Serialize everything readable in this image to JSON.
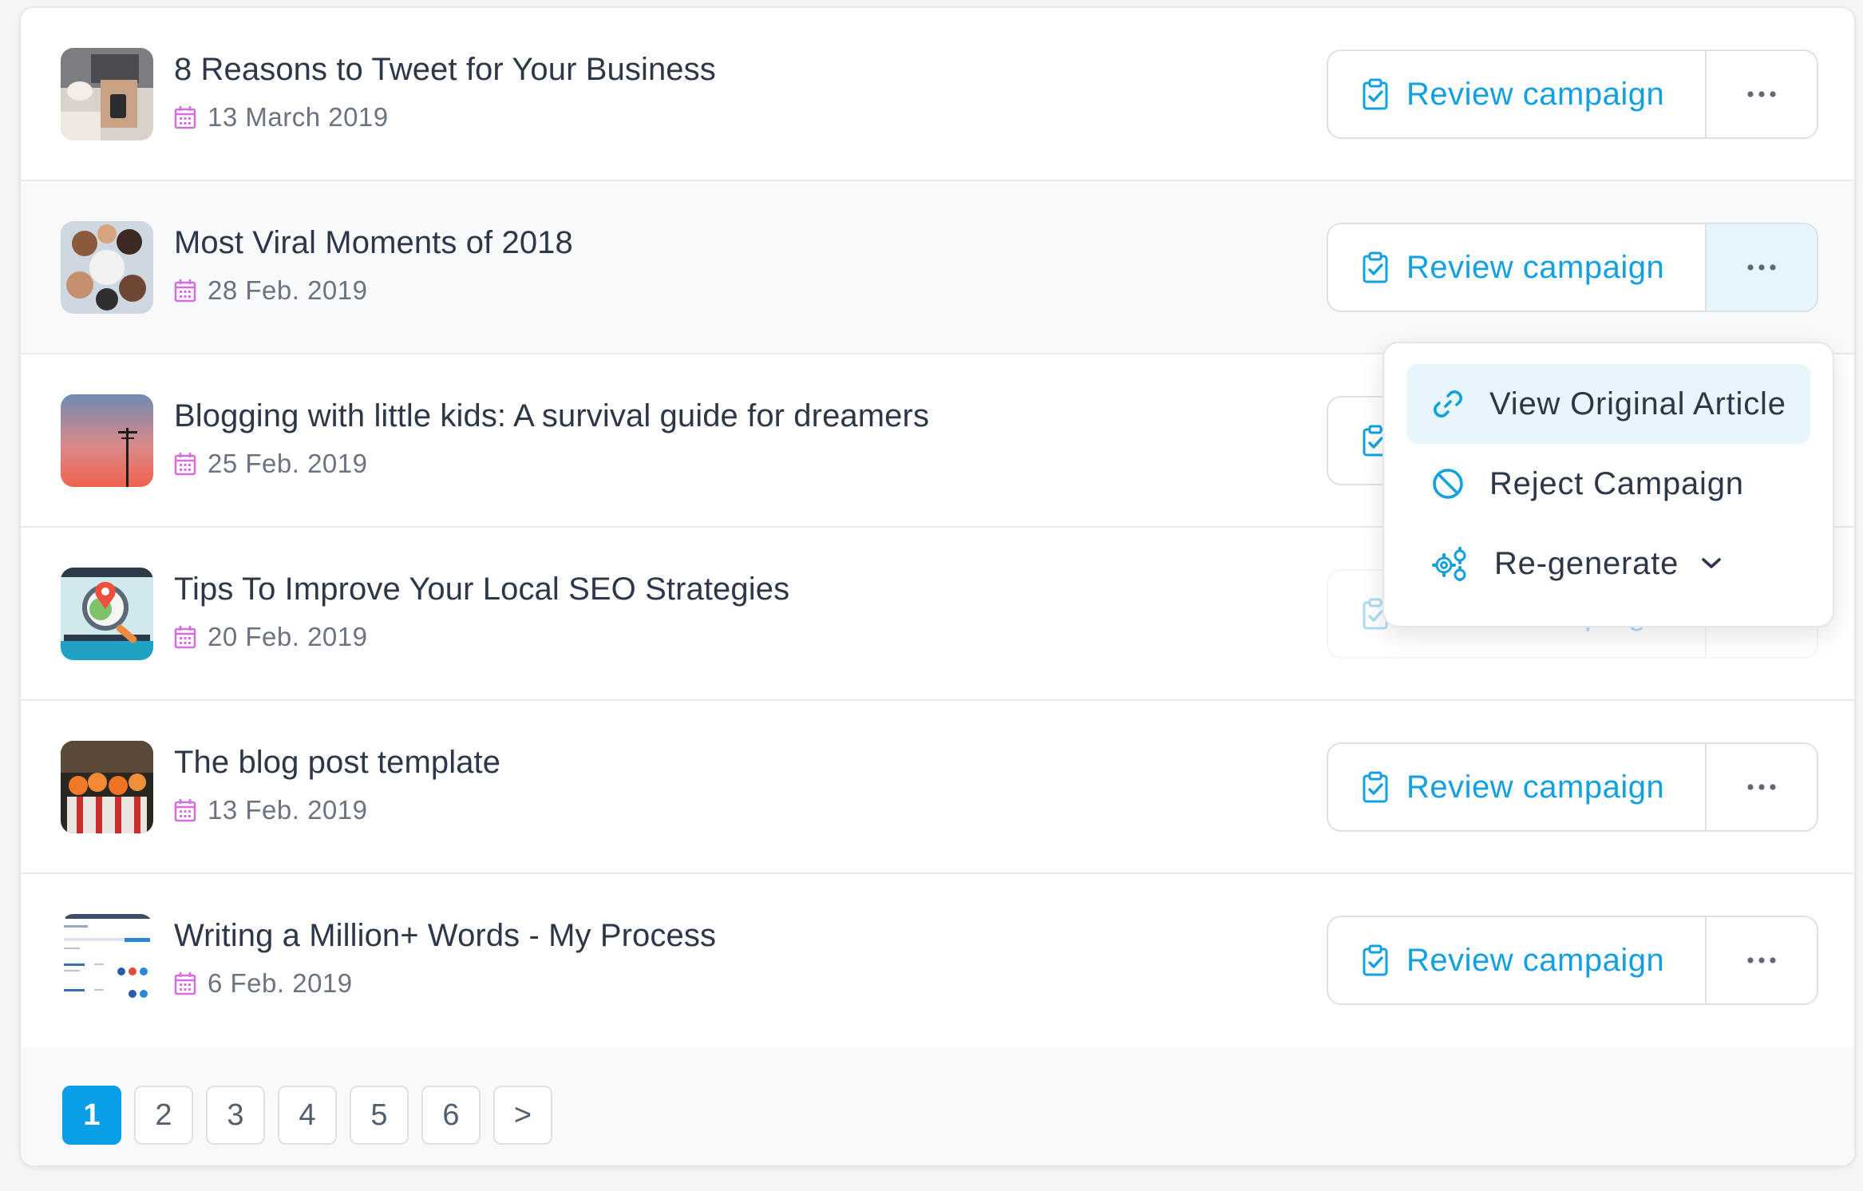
{
  "colors": {
    "accent": "#12a0e0",
    "calendar_icon": "#d46fdc",
    "page_current": "#0b9fe8"
  },
  "review_label": "Review campaign",
  "icons": {
    "calendar": "calendar-icon",
    "review": "clipboard-check-icon",
    "more": "more-horizontal-icon",
    "link": "link-icon",
    "reject": "ban-icon",
    "regenerate": "gears-icon",
    "chevron": "chevron-down-icon"
  },
  "articles": [
    {
      "title": "8 Reasons to Tweet for Your Business",
      "date": "13 March 2019"
    },
    {
      "title": "Most Viral Moments of 2018",
      "date": "28 Feb. 2019"
    },
    {
      "title": "Blogging with little kids: A survival guide for dreamers",
      "date": "25 Feb. 2019"
    },
    {
      "title": "Tips To Improve Your Local SEO Strategies",
      "date": "20 Feb. 2019"
    },
    {
      "title": "The blog post template",
      "date": "13 Feb. 2019"
    },
    {
      "title": "Writing a Million+ Words - My Process",
      "date": "6 Feb. 2019"
    }
  ],
  "dropdown": {
    "items": [
      {
        "label": "View Original Article"
      },
      {
        "label": "Reject Campaign"
      },
      {
        "label": "Re-generate"
      }
    ]
  },
  "pagination": {
    "pages": [
      "1",
      "2",
      "3",
      "4",
      "5",
      "6"
    ],
    "next": ">",
    "current": "1"
  }
}
